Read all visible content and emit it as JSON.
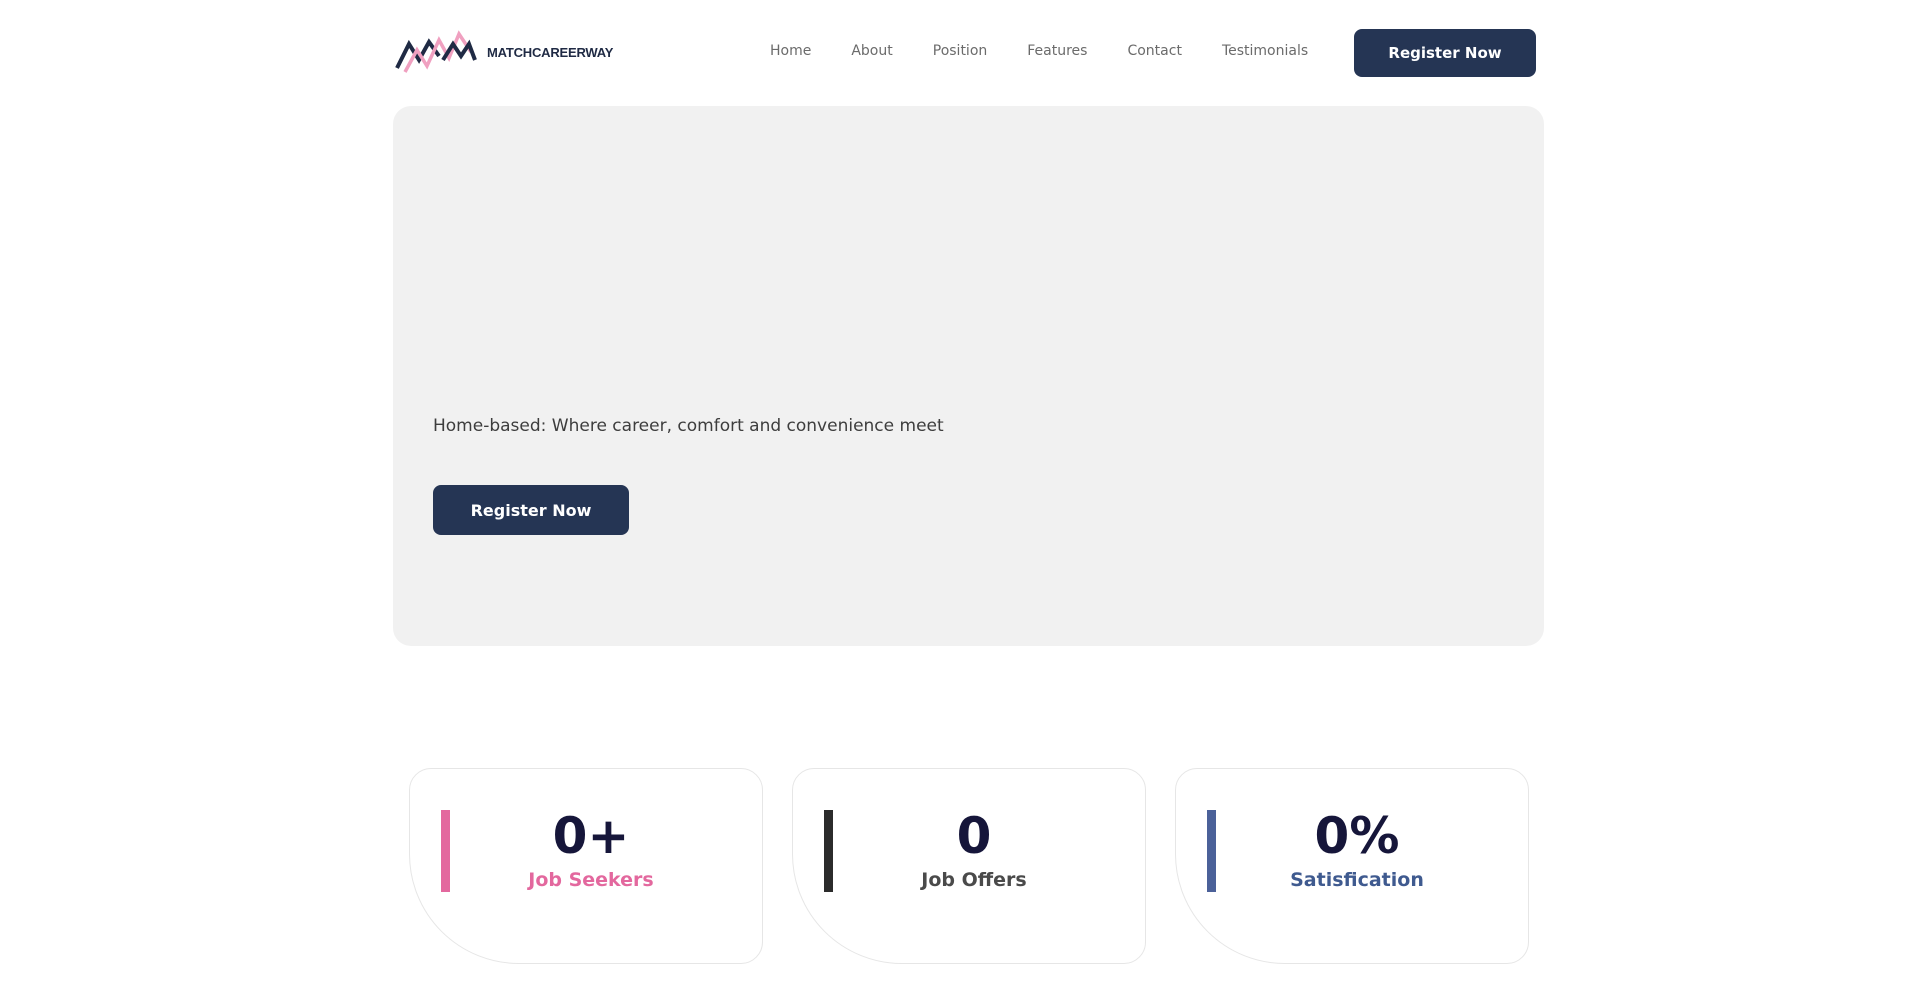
{
  "brand": {
    "name": "MATCHCAREERWAY",
    "colors": {
      "navy": "#253554",
      "pink": "#e3689e",
      "dark": "#2b2b2b",
      "blue": "#4b6199"
    }
  },
  "nav": {
    "items": [
      {
        "label": "Home"
      },
      {
        "label": "About"
      },
      {
        "label": "Position"
      },
      {
        "label": "Features"
      },
      {
        "label": "Contact"
      },
      {
        "label": "Testimonials"
      }
    ],
    "cta_label": "Register Now"
  },
  "hero": {
    "tagline": "Home-based: Where career, comfort and convenience meet",
    "cta_label": "Register Now"
  },
  "stats": [
    {
      "value": "0+",
      "label": "Job Seekers",
      "accent": "#e3689e",
      "label_color": "#e3689e"
    },
    {
      "value": "0",
      "label": "Job Offers",
      "accent": "#2b2b2b",
      "label_color": "#4a4a4a"
    },
    {
      "value": "0%",
      "label": "Satisfication",
      "accent": "#4b6199",
      "label_color": "#3f5a8f"
    }
  ]
}
